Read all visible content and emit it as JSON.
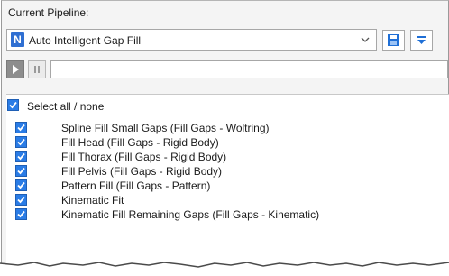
{
  "pipeline": {
    "label": "Current Pipeline:",
    "badge": "N",
    "selected": "Auto Intelligent Gap Fill"
  },
  "toolbar": {
    "play": "play-icon",
    "pause": "pause-icon",
    "save": "save-icon",
    "menu": "filter-dropdown-icon"
  },
  "select_all": {
    "label": "Select all / none",
    "checked": true
  },
  "operations": [
    {
      "label": "Spline Fill Small Gaps (Fill Gaps - Woltring)",
      "checked": true
    },
    {
      "label": "Fill Head (Fill Gaps - Rigid Body)",
      "checked": true
    },
    {
      "label": "Fill Thorax (Fill Gaps - Rigid Body)",
      "checked": true
    },
    {
      "label": "Fill Pelvis (Fill Gaps - Rigid Body)",
      "checked": true
    },
    {
      "label": "Pattern Fill (Fill Gaps - Pattern)",
      "checked": true
    },
    {
      "label": "Kinematic Fit",
      "checked": true
    },
    {
      "label": "Kinematic Fill Remaining Gaps (Fill Gaps - Kinematic)",
      "checked": true
    }
  ],
  "colors": {
    "checkbox": "#2a7ce6",
    "badge": "#2f6fd2",
    "icon_blue": "#1f6fd6"
  }
}
